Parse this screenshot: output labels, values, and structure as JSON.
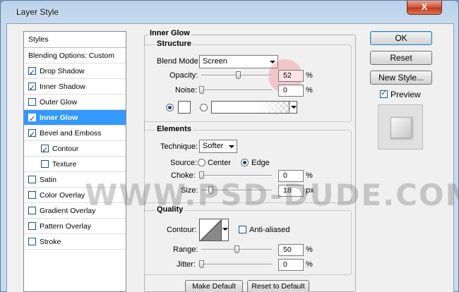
{
  "window": {
    "title": "Layer Style",
    "close_glyph": "X"
  },
  "styles_panel": {
    "header": "Styles",
    "items": [
      {
        "label": "Blending Options: Custom",
        "has_checkbox": false,
        "checked": false
      },
      {
        "label": "Drop Shadow",
        "has_checkbox": true,
        "checked": true
      },
      {
        "label": "Inner Shadow",
        "has_checkbox": true,
        "checked": true
      },
      {
        "label": "Outer Glow",
        "has_checkbox": true,
        "checked": false
      },
      {
        "label": "Inner Glow",
        "has_checkbox": true,
        "checked": true,
        "active": true
      },
      {
        "label": "Bevel and Emboss",
        "has_checkbox": true,
        "checked": true
      },
      {
        "label": "Contour",
        "has_checkbox": true,
        "checked": true,
        "sub": true
      },
      {
        "label": "Texture",
        "has_checkbox": true,
        "checked": false,
        "sub": true
      },
      {
        "label": "Satin",
        "has_checkbox": true,
        "checked": false
      },
      {
        "label": "Color Overlay",
        "has_checkbox": true,
        "checked": false
      },
      {
        "label": "Gradient Overlay",
        "has_checkbox": true,
        "checked": false
      },
      {
        "label": "Pattern Overlay",
        "has_checkbox": true,
        "checked": false
      },
      {
        "label": "Stroke",
        "has_checkbox": true,
        "checked": false
      }
    ]
  },
  "inner_glow": {
    "title": "Inner Glow",
    "structure": {
      "title": "Structure",
      "blend_mode_label": "Blend Mode:",
      "blend_mode_value": "Screen",
      "opacity_label": "Opacity:",
      "opacity_value": "52",
      "opacity_fraction": 0.52,
      "noise_label": "Noise:",
      "noise_value": "0",
      "noise_fraction": 0,
      "percent": "%",
      "glow_color": "#ffffff"
    },
    "elements": {
      "title": "Elements",
      "technique_label": "Technique:",
      "technique_value": "Softer",
      "source_label": "Source:",
      "source_center": "Center",
      "source_edge": "Edge",
      "choke_label": "Choke:",
      "choke_value": "0",
      "size_label": "Size:",
      "size_value": "18",
      "px": "px",
      "percent": "%"
    },
    "quality": {
      "title": "Quality",
      "contour_label": "Contour:",
      "anti_aliased_label": "Anti-aliased",
      "range_label": "Range:",
      "range_value": "50",
      "range_fraction": 0.5,
      "jitter_label": "Jitter:",
      "jitter_value": "0",
      "percent": "%"
    },
    "make_default": "Make Default",
    "reset_default": "Reset to Default"
  },
  "buttons": {
    "ok": "OK",
    "reset": "Reset",
    "new_style": "New Style...",
    "preview": "Preview"
  },
  "watermark": "WWW.PSD-DUDE.COM",
  "colors": {
    "accent": "#3399ff",
    "title_bar": "#b9d1ea",
    "close": "#c0391c"
  }
}
